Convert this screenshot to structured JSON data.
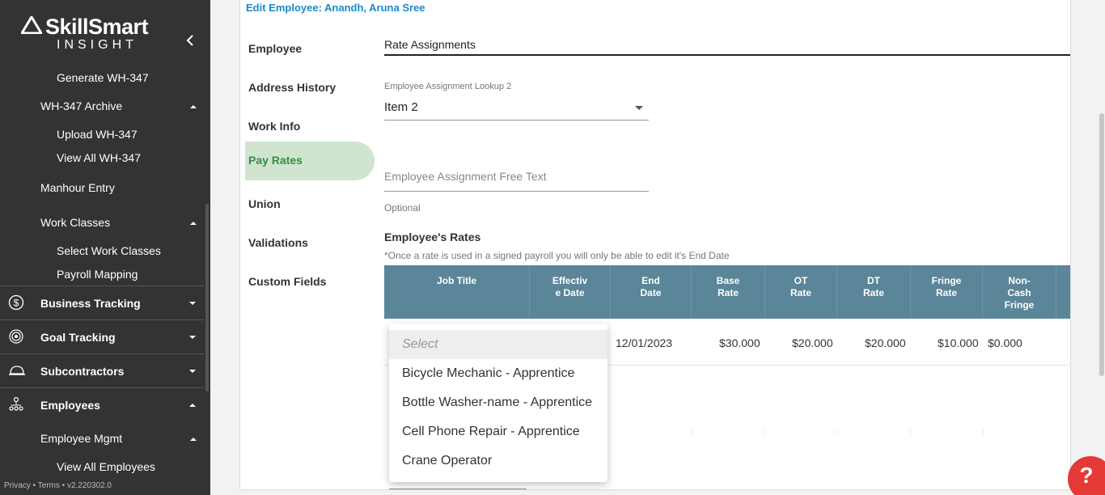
{
  "brand": {
    "name": "SkillSmart",
    "sub": "INSIGHT"
  },
  "sidebar": {
    "items": [
      {
        "label": "Generate WH-347"
      },
      {
        "label": "WH-347 Archive"
      },
      {
        "label": "Upload WH-347"
      },
      {
        "label": "View All WH-347"
      },
      {
        "label": "Manhour Entry"
      },
      {
        "label": "Work Classes"
      },
      {
        "label": "Select Work Classes"
      },
      {
        "label": "Payroll Mapping"
      }
    ],
    "main_items": [
      {
        "label": "Business Tracking",
        "icon": "dollar-icon"
      },
      {
        "label": "Goal Tracking",
        "icon": "target-icon"
      },
      {
        "label": "Subcontractors",
        "icon": "hard-hat-icon"
      },
      {
        "label": "Employees",
        "icon": "org-chart-icon"
      }
    ],
    "employee_sub": [
      {
        "label": "Employee Mgmt"
      },
      {
        "label": "View All Employees"
      }
    ],
    "footer": "Privacy • Terms • v2.220302.0"
  },
  "page": {
    "edit_title": "Edit Employee: Anandh, Aruna Sree",
    "tabs": [
      {
        "label": "Employee"
      },
      {
        "label": "Address History"
      },
      {
        "label": "Work Info"
      },
      {
        "label": "Pay Rates"
      },
      {
        "label": "Union"
      },
      {
        "label": "Validations"
      },
      {
        "label": "Custom Fields"
      }
    ],
    "section_title": "Rate Assignments",
    "lookup_label": "Employee Assignment Lookup 2",
    "lookup_value": "Item 2",
    "free_text_placeholder": "Employee Assignment Free Text",
    "optional": "Optional",
    "rates_label": "Employee's Rates",
    "rates_note": "*Once a rate is used in a signed payroll you will only be able to edit it's End Date"
  },
  "table": {
    "headers": [
      {
        "line1": "Job Title",
        "line2": "",
        "line3": ""
      },
      {
        "line1": "Effectiv",
        "line2": "e Date",
        "line3": ""
      },
      {
        "line1": "End",
        "line2": "Date",
        "line3": ""
      },
      {
        "line1": "Base",
        "line2": "Rate",
        "line3": ""
      },
      {
        "line1": "OT",
        "line2": "Rate",
        "line3": ""
      },
      {
        "line1": "DT",
        "line2": "Rate",
        "line3": ""
      },
      {
        "line1": "Fringe",
        "line2": "Rate",
        "line3": ""
      },
      {
        "line1": "Non-",
        "line2": "Cash",
        "line3": "Fringe"
      }
    ],
    "row": {
      "end_date": "12/01/2023",
      "base_rate": "$30.000",
      "ot_rate": "$20.000",
      "dt_rate": "$20.000",
      "fringe_rate": "$10.000",
      "non_cash_fringe": "$0.000"
    }
  },
  "dropdown": {
    "placeholder": "Select",
    "options": [
      "Bicycle Mechanic - Apprentice",
      "Bottle Washer-name - Apprentice",
      "Cell Phone Repair - Apprentice",
      "Crane Operator"
    ]
  },
  "help": {
    "label": "?"
  },
  "colors": {
    "sidebar_bg": "#333333",
    "table_header": "#5b8598",
    "active_tab_bg": "#cfe5d0",
    "active_tab_text": "#3a8a40",
    "link_blue": "#1e88c9",
    "help_red": "#e53935"
  }
}
